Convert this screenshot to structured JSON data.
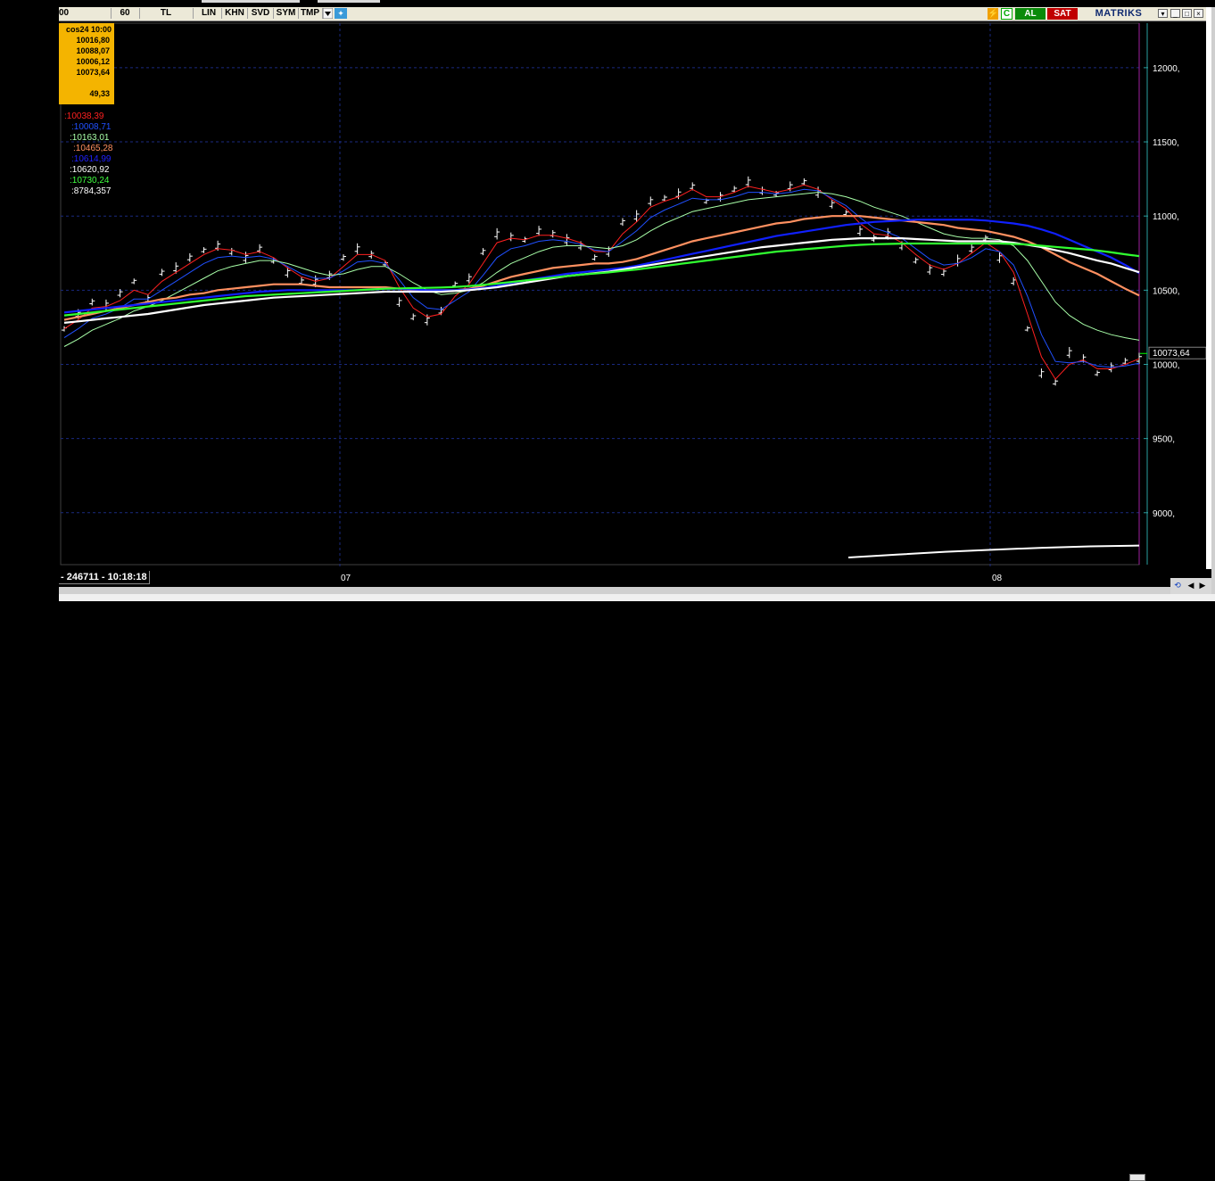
{
  "toolbar": {
    "items": [
      "00",
      "60",
      "TL",
      "LIN",
      "KHN",
      "SVD",
      "SYM",
      "TMP"
    ],
    "al_label": "AL",
    "sat_label": "SAT",
    "brand": "MATRIKS",
    "c_label": "C"
  },
  "infobox": {
    "date_line": "cos24 10:00",
    "values": [
      "10016,80",
      "10088,07",
      "10006,12",
      "10073,64"
    ],
    "extra": "49,33"
  },
  "indicators": [
    {
      "text": ":10038,39",
      "color": "#ff2020"
    },
    {
      "text": ":10008,71",
      "color": "#2050ff"
    },
    {
      "text": ":10163,01",
      "color": "#a8ffa8"
    },
    {
      "text": ":10465,28",
      "color": "#ff9060"
    },
    {
      "text": ":10614,99",
      "color": "#2020ff"
    },
    {
      "text": ":10620,92",
      "color": "#ffffff"
    },
    {
      "text": ":10730,24",
      "color": "#40ff40"
    },
    {
      "text": ":8784,357",
      "color": "#ffffff"
    }
  ],
  "status": {
    "text": "- 246711 - 10:18:18",
    "xlabels": [
      "07",
      "08"
    ]
  },
  "chart_data": {
    "type": "line",
    "title": "",
    "ylim": [
      8650,
      12300
    ],
    "y_ticks": [
      9000,
      9500,
      10000,
      10500,
      11000,
      11500,
      12000
    ],
    "y_tick_labels": [
      "9000,",
      "9500,",
      "10000,",
      "10500,",
      "11000,",
      "11500,",
      "12000,"
    ],
    "last_price": 10073.64,
    "last_price_label": "10073,64",
    "x_labels": [
      "07",
      "08"
    ],
    "grid": true,
    "price": [
      10240,
      10340,
      10420,
      10400,
      10480,
      10560,
      10440,
      10620,
      10650,
      10720,
      10770,
      10800,
      10760,
      10720,
      10780,
      10700,
      10620,
      10560,
      10560,
      10600,
      10720,
      10780,
      10740,
      10680,
      10420,
      10320,
      10300,
      10360,
      10540,
      10580,
      10760,
      10880,
      10860,
      10840,
      10900,
      10880,
      10840,
      10800,
      10720,
      10760,
      10960,
      11000,
      11100,
      11120,
      11150,
      11200,
      11100,
      11130,
      11180,
      11230,
      11170,
      11150,
      11200,
      11230,
      11160,
      11080,
      11020,
      10900,
      10850,
      10880,
      10800,
      10700,
      10640,
      10620,
      10700,
      10780,
      10850,
      10720,
      10560,
      10240,
      9940,
      9880,
      10080,
      10040,
      9940,
      9980,
      10020,
      10040
    ],
    "series": [
      {
        "name": "",
        "color": "#ff2020",
        "values": [
          10240,
          10300,
          10380,
          10390,
          10430,
          10500,
          10470,
          10560,
          10620,
          10680,
          10740,
          10780,
          10770,
          10740,
          10760,
          10720,
          10650,
          10590,
          10560,
          10580,
          10660,
          10740,
          10740,
          10700,
          10520,
          10380,
          10320,
          10340,
          10460,
          10540,
          10680,
          10820,
          10850,
          10840,
          10870,
          10870,
          10850,
          10820,
          10760,
          10760,
          10880,
          10960,
          11060,
          11100,
          11130,
          11180,
          11130,
          11130,
          11160,
          11200,
          11180,
          11160,
          11180,
          11210,
          11180,
          11110,
          11050,
          10950,
          10880,
          10870,
          10820,
          10740,
          10670,
          10640,
          10680,
          10750,
          10820,
          10760,
          10620,
          10340,
          10050,
          9900,
          10000,
          10030,
          9970,
          9970,
          10000,
          10038
        ]
      },
      {
        "name": "",
        "color": "#2050ff",
        "values": [
          10180,
          10240,
          10310,
          10340,
          10380,
          10440,
          10440,
          10500,
          10560,
          10620,
          10680,
          10720,
          10730,
          10720,
          10730,
          10710,
          10660,
          10610,
          10580,
          10580,
          10630,
          10690,
          10700,
          10680,
          10570,
          10450,
          10380,
          10370,
          10430,
          10490,
          10600,
          10720,
          10780,
          10800,
          10830,
          10840,
          10830,
          10810,
          10770,
          10760,
          10830,
          10900,
          10990,
          11040,
          11080,
          11120,
          11110,
          11110,
          11130,
          11160,
          11160,
          11150,
          11160,
          11180,
          11170,
          11120,
          11070,
          10990,
          10920,
          10890,
          10850,
          10780,
          10710,
          10670,
          10680,
          10720,
          10780,
          10760,
          10670,
          10460,
          10200,
          10020,
          10010,
          10020,
          9990,
          9980,
          9990,
          10008
        ]
      },
      {
        "name": "",
        "color": "#a8ffa8",
        "values": [
          10120,
          10170,
          10230,
          10270,
          10310,
          10360,
          10390,
          10430,
          10480,
          10530,
          10580,
          10630,
          10660,
          10680,
          10700,
          10700,
          10680,
          10650,
          10620,
          10600,
          10610,
          10640,
          10660,
          10660,
          10610,
          10550,
          10500,
          10470,
          10480,
          10500,
          10550,
          10620,
          10680,
          10720,
          10760,
          10790,
          10800,
          10800,
          10790,
          10780,
          10800,
          10840,
          10900,
          10950,
          10990,
          11030,
          11050,
          11070,
          11090,
          11110,
          11120,
          11130,
          11140,
          11150,
          11160,
          11150,
          11130,
          11100,
          11060,
          11030,
          11000,
          10960,
          10920,
          10880,
          10860,
          10850,
          10850,
          10840,
          10800,
          10700,
          10560,
          10420,
          10330,
          10270,
          10230,
          10200,
          10180,
          10163
        ]
      },
      {
        "name": "",
        "color": "#ff9060",
        "values": [
          10300,
          10320,
          10340,
          10360,
          10380,
          10400,
          10420,
          10440,
          10450,
          10470,
          10480,
          10500,
          10510,
          10520,
          10530,
          10540,
          10540,
          10540,
          10530,
          10520,
          10520,
          10520,
          10520,
          10520,
          10510,
          10500,
          10500,
          10500,
          10500,
          10510,
          10530,
          10560,
          10590,
          10610,
          10630,
          10650,
          10660,
          10670,
          10680,
          10680,
          10690,
          10710,
          10740,
          10770,
          10800,
          10830,
          10850,
          10870,
          10890,
          10910,
          10930,
          10950,
          10960,
          10980,
          10990,
          11000,
          11000,
          11000,
          10990,
          10980,
          10970,
          10960,
          10950,
          10940,
          10920,
          10910,
          10900,
          10880,
          10860,
          10830,
          10790,
          10740,
          10690,
          10650,
          10610,
          10560,
          10510,
          10465
        ]
      },
      {
        "name": "",
        "color": "#1020ff",
        "values": [
          10350,
          10360,
          10370,
          10380,
          10390,
          10400,
          10410,
          10420,
          10430,
          10440,
          10450,
          10460,
          10470,
          10480,
          10490,
          10495,
          10500,
          10500,
          10500,
          10500,
          10500,
          10500,
          10505,
          10510,
          10510,
          10505,
          10500,
          10500,
          10500,
          10505,
          10515,
          10530,
          10550,
          10565,
          10580,
          10595,
          10610,
          10620,
          10630,
          10640,
          10650,
          10665,
          10685,
          10705,
          10725,
          10745,
          10765,
          10785,
          10805,
          10825,
          10845,
          10865,
          10880,
          10895,
          10910,
          10925,
          10940,
          10950,
          10960,
          10965,
          10970,
          10975,
          10975,
          10975,
          10975,
          10975,
          10970,
          10960,
          10950,
          10935,
          10910,
          10880,
          10840,
          10800,
          10760,
          10720,
          10670,
          10615
        ]
      },
      {
        "name": "",
        "color": "#ffffff",
        "values": [
          10280,
          10290,
          10300,
          10310,
          10320,
          10330,
          10340,
          10355,
          10370,
          10385,
          10400,
          10410,
          10420,
          10430,
          10440,
          10450,
          10455,
          10460,
          10465,
          10470,
          10475,
          10480,
          10485,
          10490,
          10490,
          10490,
          10490,
          10490,
          10495,
          10500,
          10510,
          10520,
          10535,
          10550,
          10565,
          10580,
          10595,
          10605,
          10615,
          10625,
          10640,
          10655,
          10670,
          10685,
          10700,
          10715,
          10730,
          10745,
          10760,
          10775,
          10790,
          10800,
          10810,
          10820,
          10830,
          10840,
          10845,
          10850,
          10850,
          10850,
          10850,
          10845,
          10840,
          10835,
          10830,
          10830,
          10830,
          10830,
          10820,
          10805,
          10790,
          10770,
          10750,
          10725,
          10700,
          10680,
          10650,
          10621
        ]
      },
      {
        "name": "",
        "color": "#30ff30",
        "values": [
          10330,
          10340,
          10350,
          10360,
          10370,
          10380,
          10390,
          10400,
          10410,
          10420,
          10430,
          10440,
          10450,
          10460,
          10465,
          10470,
          10475,
          10480,
          10485,
          10490,
          10495,
          10500,
          10505,
          10510,
          10512,
          10514,
          10516,
          10518,
          10522,
          10528,
          10536,
          10545,
          10555,
          10565,
          10575,
          10585,
          10595,
          10605,
          10612,
          10620,
          10630,
          10640,
          10652,
          10664,
          10676,
          10688,
          10700,
          10712,
          10724,
          10736,
          10748,
          10760,
          10768,
          10776,
          10784,
          10792,
          10800,
          10806,
          10810,
          10812,
          10814,
          10815,
          10815,
          10815,
          10815,
          10815,
          10815,
          10815,
          10812,
          10808,
          10800,
          10792,
          10784,
          10776,
          10768,
          10755,
          10742,
          10730
        ]
      }
    ],
    "volume_curve": [
      8700,
      8720,
      8740,
      8755,
      8768,
      8778,
      8784
    ]
  }
}
